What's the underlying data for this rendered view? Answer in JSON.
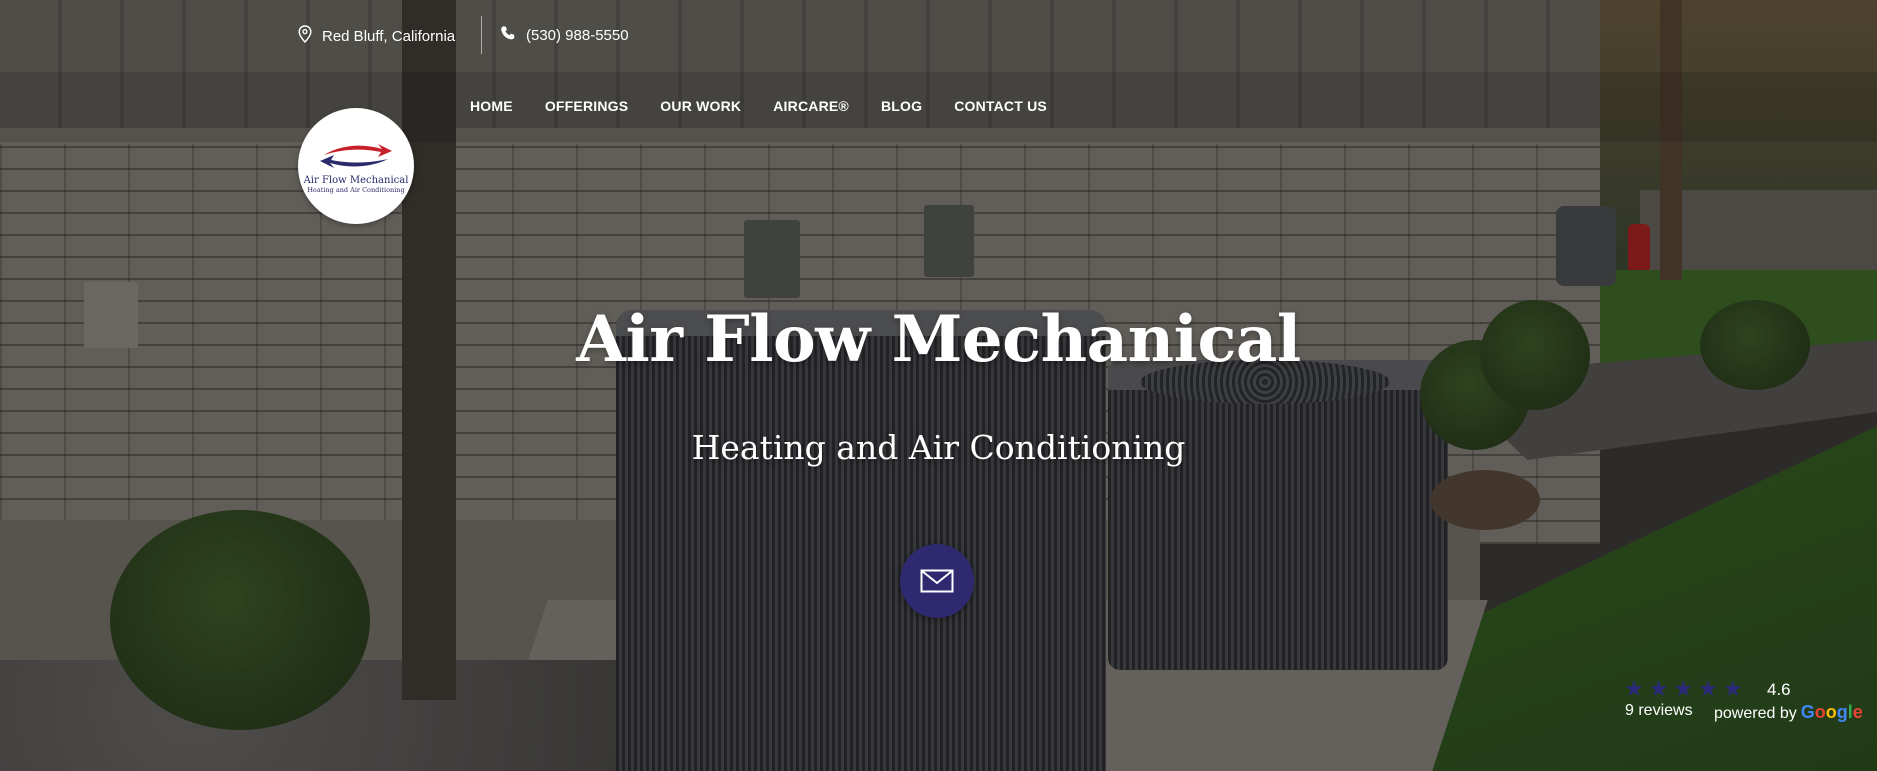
{
  "topbar": {
    "location": "Red Bluff, California",
    "phone": "(530) 988-5550",
    "location_icon": "map-pin-icon",
    "phone_icon": "phone-icon"
  },
  "nav": {
    "items": [
      {
        "label": "HOME"
      },
      {
        "label": "OFFERINGS"
      },
      {
        "label": "OUR WORK"
      },
      {
        "label": "AIRCARE®"
      },
      {
        "label": "BLOG"
      },
      {
        "label": "CONTACT US"
      }
    ]
  },
  "logo": {
    "name": "Air Flow Mechanical",
    "tagline": "Heating and Air Conditioning"
  },
  "hero": {
    "title": "Air Flow Mechanical",
    "subtitle": "Heating and Air Conditioning",
    "cta_icon": "envelope-icon"
  },
  "reviews": {
    "rating": "4.6",
    "stars": 5,
    "count": "9 reviews",
    "powered_by": "powered by",
    "provider": [
      "G",
      "o",
      "o",
      "g",
      "l",
      "e"
    ]
  },
  "colors": {
    "brand_navy": "#2f2a70",
    "star": "#2b2a7a",
    "logo_red": "#c8202a",
    "logo_blue": "#2b2a6b"
  }
}
